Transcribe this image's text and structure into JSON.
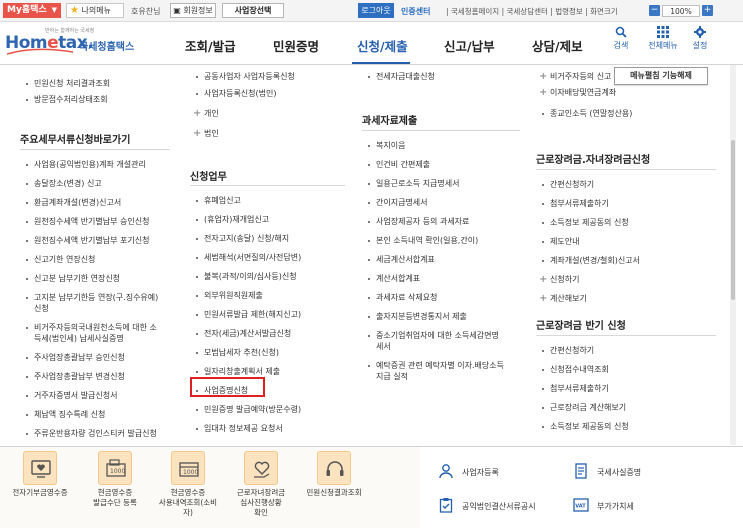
{
  "topbar": {
    "my_tax": "My홈택스",
    "my_menu": "나의메뉴",
    "greeting": "호유찬님",
    "member_info": "회원정보",
    "biz_select": "사업장선택",
    "logout": "로그아웃",
    "cert_center": "인증센터",
    "util_links": "| 국세청홈페이지 | 국세상담센터 | 법령정보 | 화면크기",
    "zoom_minus": "−",
    "zoom_value": "100%",
    "zoom_plus": "+"
  },
  "logo": {
    "slogan": "반하는 함께하는 국세청",
    "home": "Hom",
    "e": "e",
    "tax": "tax.",
    "nts": "국세청홈택스"
  },
  "nav": {
    "items": [
      "조회/발급",
      "민원증명",
      "신청/제출",
      "신고/납부",
      "상담/제보"
    ],
    "active_index": 2,
    "search": "검색",
    "all_menu": "전체메뉴",
    "settings": "설정"
  },
  "content": {
    "release_button": "메뉴펼침 기능해제",
    "col1": {
      "top_items": [
        "민원신청 처리결과조회",
        "방문접수처리상태조회"
      ],
      "heading": "주요세무서류신청바로가기",
      "items": [
        "사업용(공익법인용)계좌 개설관리",
        "송달장소(변경) 신고",
        "환급계좌개설(변경)신고서",
        "원천징수세액 반기별납부 승인신청",
        "원천징수세액 반기별납부 포기신청",
        "신고기한 연장신청",
        "신고분 납부기한 연장신청",
        "고지분 납부기한등 연장(구.징수유예)\n신청",
        "비거주자등의국내원천소득에 대한 소\n득세(법인세) 납세사실증명",
        "주사업장총괄납부 승인신청",
        "주사업장총괄납부 변경신청",
        "거주자증명서 발급신청서",
        "체납액 징수특례 신청",
        "주류운반용차량 검인스티커 발급신청"
      ]
    },
    "col2": {
      "top_items": [
        "공동사업자 사업자등록신청",
        "사업자등록신청(법인)"
      ],
      "plus_items": [
        "개인",
        "법인"
      ],
      "heading": "신청업무",
      "items": [
        "휴폐업신고",
        "(휴업자)재개업신고",
        "전자고지(송달) 신청/해지",
        "세법해석(서면질의/사전답변)",
        "불복(과적/이의/심사등)신청",
        "외부위원직원제출",
        "민원서류발급 제한(해지신고)",
        "전자(세금)계산서발급신청",
        "모범납세자 추천(신청)",
        "일자리창출계획서 제출",
        "사업증명신청",
        "민원증명 발급예약(방문수령)",
        "임대차 정보제공 요청서"
      ],
      "highlight_index": 10
    },
    "col3": {
      "top_items": [
        "전세자금대출신청"
      ],
      "heading": "과세자료제출",
      "items": [
        "복지이음",
        "인건비 간편제출",
        "일용근로소득 지급명세서",
        "간이지급명세서",
        "사업장제공자 등의 과세자료",
        "본인 소득내역 확인(일용,간이)",
        "세금계산서합계표",
        "계산서합계표",
        "과세자료 삭제요청",
        "출자지분등변경통지서 제출",
        "중소기업취업자에 대한 소득세감면명\n세서",
        "예탁증권 관련 예탁자별 이자.배당소득\n지급 실적"
      ]
    },
    "col4": {
      "top_plus": [
        "비거주자등의 신고"
      ],
      "top_items": [
        "이자배당및연금계좌",
        "종교인소득 (연말정산용)"
      ],
      "heading1": "근로장려금.자녀장려금신청",
      "items1": [
        "간편신청하기",
        "첨부서류제출하기",
        "소득정보 제공동의 신청",
        "제도안내",
        "계좌개설(변경/철회)신고서"
      ],
      "plus1": [
        "신청하기",
        "계산해보기"
      ],
      "heading2": "근로장려금 반기 신청",
      "items2": [
        "간편신청하기",
        "신청접수내역조회",
        "첨부서류제출하기",
        "근로장려금 계산해보기",
        "소득정보 제공동의 신청"
      ]
    }
  },
  "bottom": {
    "quick": [
      {
        "label": "전자기부금영수증",
        "icon": "monitor-heart-icon"
      },
      {
        "label": "현금영수증\n발급수단 등록",
        "icon": "cash-register-icon"
      },
      {
        "label": "현금영수증\n사용내역조회(소비\n자)",
        "icon": "cash-receipt-icon"
      },
      {
        "label": "근로자녀장려금\n심사진행상황\n확인",
        "icon": "heart-hand-icon"
      },
      {
        "label": "민원신청결과조회",
        "icon": "headset-icon"
      }
    ],
    "right": [
      {
        "label": "사업자등록",
        "icon": "person-icon"
      },
      {
        "label": "국세사실증명",
        "icon": "document-icon"
      },
      {
        "label": "공익법인결산서류공시",
        "icon": "clipboard-check-icon"
      },
      {
        "label": "부가가치세",
        "icon": "vat-icon"
      }
    ]
  },
  "colors": {
    "brand_blue": "#2560b0",
    "my_tax_red": "#e8544a",
    "highlight_red": "#e02020",
    "quick_icon_bg": "#fbe3bf"
  }
}
